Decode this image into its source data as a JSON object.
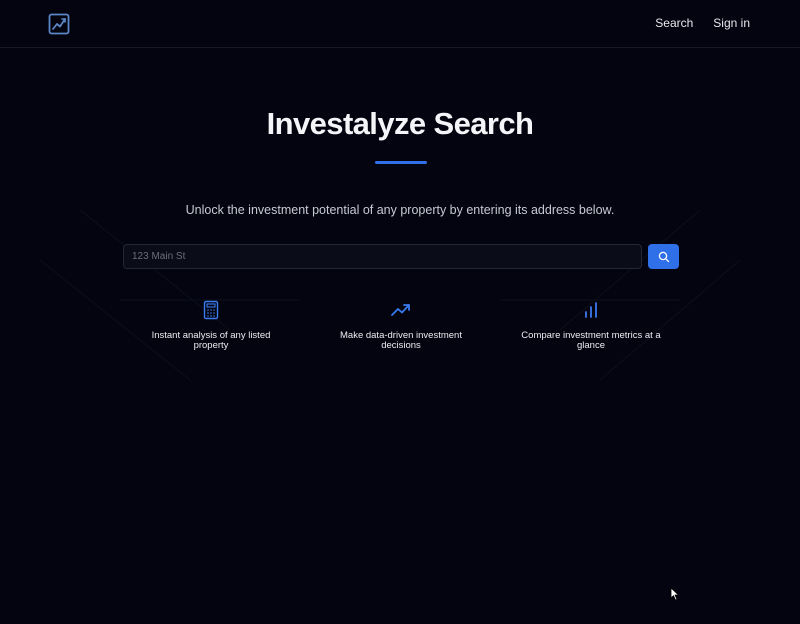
{
  "header": {
    "logo_icon": "chart-line-square-icon",
    "nav": {
      "search_label": "Search",
      "signin_label": "Sign in"
    }
  },
  "hero": {
    "title": "Investalyze Search",
    "subtitle": "Unlock the investment potential of any property by entering its address below."
  },
  "search": {
    "placeholder": "123 Main St",
    "value": "",
    "button_icon": "search-icon"
  },
  "features": [
    {
      "icon": "calculator-icon",
      "label": "Instant analysis of any listed property"
    },
    {
      "icon": "trending-up-icon",
      "label": "Make data-driven investment decisions"
    },
    {
      "icon": "bar-chart-icon",
      "label": "Compare investment metrics at a glance"
    }
  ],
  "colors": {
    "background": "#03040f",
    "accent": "#2f6fe8",
    "text": "#f4f5f8",
    "muted_text": "#c7c9d3"
  }
}
